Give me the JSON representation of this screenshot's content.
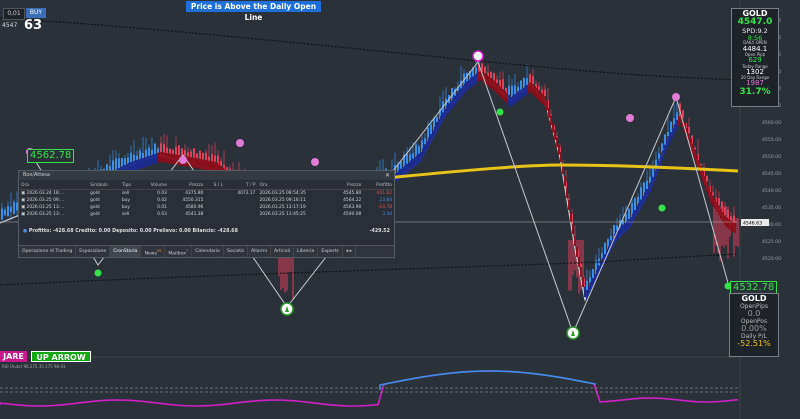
{
  "trade_widget": {
    "lot": "0,01",
    "buy_label": "BUY",
    "bid_small": "4547",
    "bid_big": "63"
  },
  "banner": "Price is Above the Daily Open Line",
  "price_labels": {
    "left": "4562.78",
    "right": "4532.78"
  },
  "info_panel": {
    "symbol": "GOLD",
    "price": "4547.0",
    "spread": "SPD:9.2",
    "timer": "8:56",
    "daily_open_label": "DAILY OPEN",
    "daily_open": "4484.1",
    "open_pips_label": "Open Pip$",
    "open_pips": "629",
    "today_range_label": "Today Range",
    "today_range": "1302",
    "range20_label": "20 Day Range",
    "range20": "1987",
    "percent": "31.7%"
  },
  "info_panel2": {
    "symbol": "GOLD",
    "open_pips_label": "OpenPips",
    "open_pips": "0.0",
    "open_pos_label": "OpenPos",
    "open_pos": "0.00%",
    "daily_pl_label": "Daily P/L",
    "daily_pl": "-52.51%"
  },
  "trade_window": {
    "title": "Box/Attesa",
    "columns": [
      "Ora",
      "Simbolo",
      "Tipo",
      "Volume",
      "Prezzo",
      "S / L",
      "T / P",
      "Ora",
      "Prezzo",
      "Profitto"
    ],
    "rows": [
      [
        "2026.03.24 18:...",
        "gold",
        "sell",
        "0.03",
        "4375.80",
        "",
        "4072.17",
        "2026.03.25 08:54:35",
        "4545.80",
        "-441.62"
      ],
      [
        "2026.03.25 09:...",
        "gold",
        "buy",
        "0.02",
        "4550.315",
        "",
        "",
        "2026.03.25 09:16:11",
        "4564.22",
        "23.84"
      ],
      [
        "2026.03.25 13:...",
        "gold",
        "buy",
        "0.01",
        "4580.96",
        "",
        "",
        "2026.03.25 13:17:19",
        "4563.90",
        "-14.78"
      ],
      [
        "2026.03.25 13:...",
        "gold",
        "sell",
        "0.03",
        "4541.38",
        "",
        "",
        "2026.03.25 13:45:25",
        "4540.08",
        "3.34"
      ]
    ],
    "profit_colors": [
      "#e0554f",
      "#4f8ee0",
      "#e0554f",
      "#4f8ee0"
    ],
    "footer": "Profitto: -428.68  Credito: 0.00  Deposito: 0.00  Prelievo: 0.00  Bilancio: -428.68",
    "footer_total": "-429.52",
    "tabs": [
      "Operazione di Trading",
      "Esposizione",
      "CronStoria",
      "News",
      "Mailbox",
      "Calendario",
      "Società",
      "Allarmi",
      "Articoli",
      "Libreria",
      "Experts"
    ],
    "tab_badges": {
      "3": "99",
      "4": "7"
    },
    "active_tab": 2
  },
  "buttons": {
    "square": "JARE",
    "up_arrow": "UP ARROW"
  },
  "indicator_label": "RSI [Auto] 96.275 35.175 98.93",
  "price_axis": [
    "4590.00",
    "4585.00",
    "4580.00",
    "4575.00",
    "4570.00",
    "4565.00",
    "4560.00",
    "4555.00",
    "4550.00",
    "4545.00",
    "4540.00",
    "4535.00",
    "4530.00",
    "4525.00",
    "4520.00"
  ],
  "price_axis_current": "4546.63",
  "colors": {
    "background": "#2b3139",
    "bull": "#3a8fe8",
    "bear": "#e0405a",
    "band_blue": "#1a2a8f",
    "band_red": "#8a0f1a",
    "daily_open": "#e8c41a",
    "green": "#34e34a",
    "magenta": "#d020c8",
    "rsi_blue": "#3a8fe8"
  }
}
